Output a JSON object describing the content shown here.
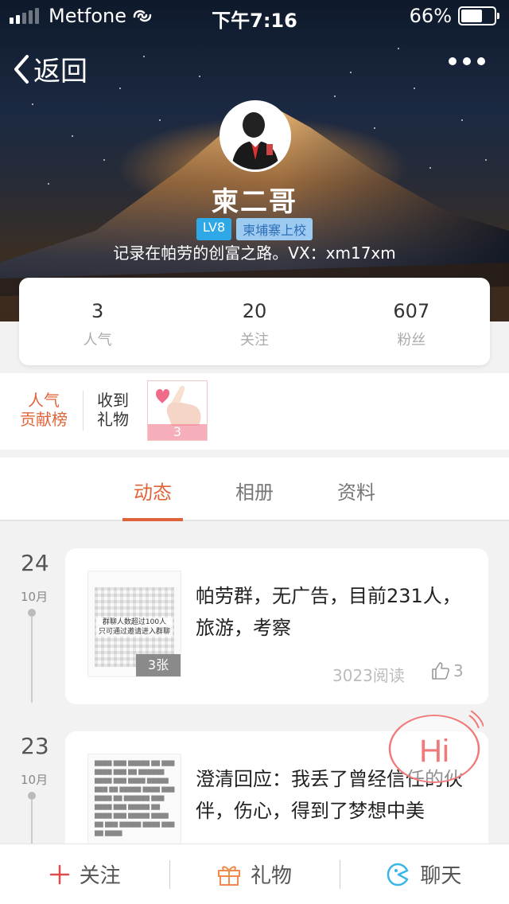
{
  "status_bar": {
    "carrier": "Metfone",
    "time": "下午7:16",
    "battery": "66%",
    "battery_level": 0.66
  },
  "nav": {
    "back_label": "返回"
  },
  "profile": {
    "name": "柬二哥",
    "level": "LV8",
    "title_badge": "柬埔寨上校",
    "bio": "记录在帕劳的创富之路。VX：xm17xm"
  },
  "stats": [
    {
      "value": "3",
      "label": "人气"
    },
    {
      "value": "20",
      "label": "关注"
    },
    {
      "value": "607",
      "label": "粉丝"
    }
  ],
  "gifts": {
    "popularity_line1": "人气",
    "popularity_line2": "贡献榜",
    "received_line1": "收到",
    "received_line2": "礼物",
    "gift_count": "3"
  },
  "tabs": [
    {
      "label": "动态",
      "active": true
    },
    {
      "label": "相册"
    },
    {
      "label": "资料"
    }
  ],
  "posts": [
    {
      "day": "24",
      "month": "10月",
      "text": "帕劳群，无广告，目前231人，旅游，考察",
      "image_count": "3张",
      "image_note": "群聊人数超过100人\n只可通过邀请进入群聊",
      "reads": "3023阅读",
      "likes": "3"
    },
    {
      "day": "23",
      "month": "10月",
      "text": "澄清回应：我丢了曾经信任的伙伴，伤心，得到了梦想中美",
      "image_count": ""
    }
  ],
  "hi_bubble": {
    "label": "Hi"
  },
  "bottom_bar": {
    "follow": "关注",
    "gift": "礼物",
    "chat": "聊天"
  },
  "colors": {
    "accent": "#e0643a",
    "lv_badge": "#2fa8e8",
    "hi": "#f07a7a"
  }
}
